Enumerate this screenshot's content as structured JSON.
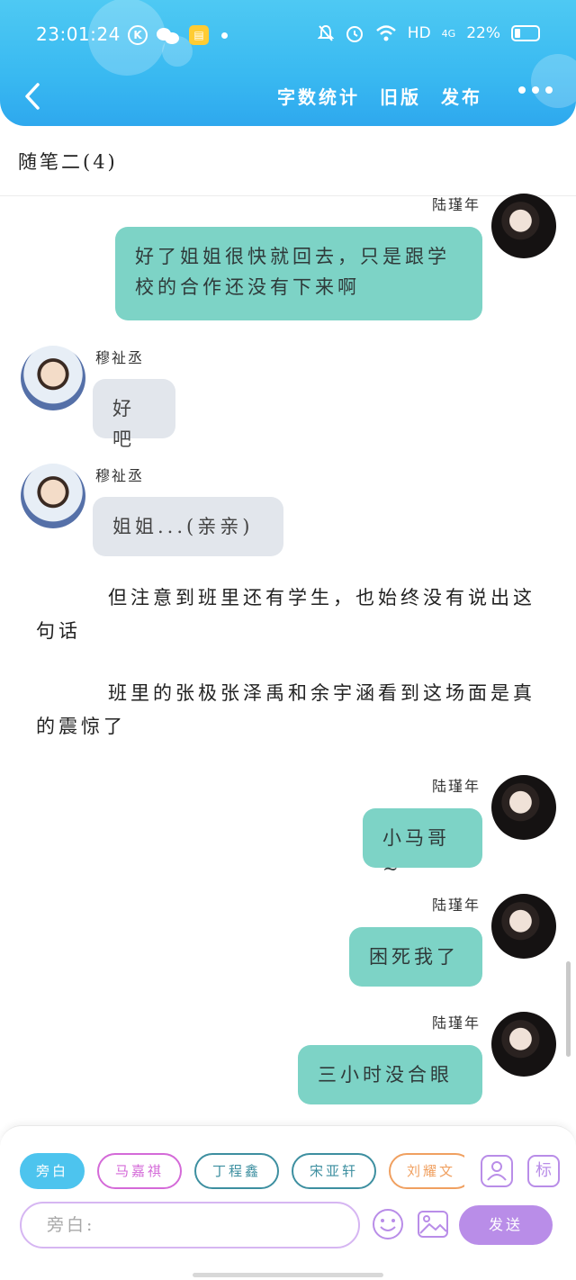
{
  "status_bar": {
    "time": "23:01:24",
    "network": "HD",
    "signal": "4G",
    "battery": "22%"
  },
  "nav": {
    "actions": [
      "字数统计",
      "旧版",
      "发布"
    ]
  },
  "doc": {
    "title": "随笔二(4)"
  },
  "messages": [
    {
      "name": "陆瑾年",
      "text": "好了姐姐很快就回去，只是跟学校的合作还没有下来啊"
    },
    {
      "name": "穆祉丞",
      "text": "好吧"
    },
    {
      "name": "穆祉丞",
      "text": "姐姐...(亲亲)"
    },
    {
      "name": "陆瑾年",
      "text": "小马哥~"
    },
    {
      "name": "陆瑾年",
      "text": "困死我了"
    },
    {
      "name": "陆瑾年",
      "text": "三小时没合眼"
    }
  ],
  "narrations": [
    "但注意到班里还有学生，也始终没有说出这句话",
    "班里的张极张泽禹和余宇涵看到这场面是真的震惊了"
  ],
  "composer": {
    "characters": [
      {
        "label": "旁白",
        "color": "#4dc4ee"
      },
      {
        "label": "马嘉祺",
        "color": "#d46ad8"
      },
      {
        "label": "丁程鑫",
        "color": "#3d8fa0"
      },
      {
        "label": "宋亚轩",
        "color": "#3d8fa0"
      },
      {
        "label": "刘耀文",
        "color": "#f0a060"
      }
    ],
    "tag_label": "标",
    "input_placeholder": "旁白:",
    "send_label": "发送"
  }
}
